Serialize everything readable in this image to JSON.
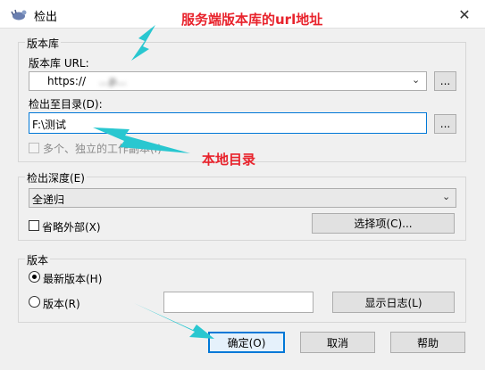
{
  "window": {
    "title": "检出",
    "close_symbol": "✕"
  },
  "repository": {
    "group_label": "版本库",
    "url_label": "版本库 URL:",
    "url_value": "https://",
    "url_blurred": "...p...",
    "browse_label": "..."
  },
  "checkout_dir": {
    "label": "检出至目录(D):",
    "value": "F:\\测试",
    "browse_label": "...",
    "standalone_checkbox": "多个、独立的工作副本(I)"
  },
  "depth": {
    "group_label": "检出深度(E)",
    "value": "全递归",
    "omit_externals": "省略外部(X)",
    "options_button": "选择项(C)..."
  },
  "revision": {
    "group_label": "版本",
    "latest": "最新版本(H)",
    "specific": "版本(R)",
    "show_log": "显示日志(L)"
  },
  "buttons": {
    "ok": "确定(O)",
    "cancel": "取消",
    "help": "帮助"
  },
  "annotations": {
    "server_url_note": "服务端版本库的url地址",
    "local_dir_note": "本地目录",
    "color": "#e8232c",
    "arrow_color": "#29c7d0"
  }
}
